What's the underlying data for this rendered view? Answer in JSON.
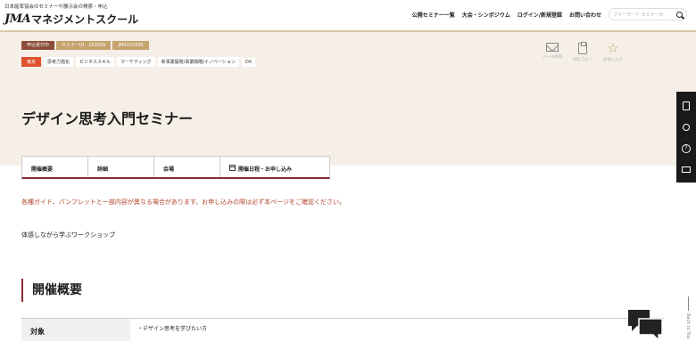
{
  "header": {
    "tagline": "日本能率協会のセミナーや展示会の検索・申込",
    "logo_jma": "JMA",
    "logo_rest": "マネジメントスクール",
    "nav": [
      {
        "label": "公開セミナー一覧"
      },
      {
        "label": "大会・シンポジウム"
      },
      {
        "label": "ログイン/新規登録"
      },
      {
        "label": "お問い合わせ"
      }
    ],
    "search_placeholder": "フリーワード セミナーの"
  },
  "seminar": {
    "status": "申込受付中",
    "seminar_id": "セミナーID：152095",
    "jma_id": "JMA152095",
    "location": "東京",
    "categories": [
      "思考力強化",
      "ビジネススキル",
      "マーケティング",
      "新事業開発/事業戦略/イノベーション",
      "DX"
    ],
    "title": "デザイン思考入門セミナー"
  },
  "actions": [
    {
      "label": "メール共有",
      "icon": "mail-share-icon"
    },
    {
      "label": "URLコピー",
      "icon": "clipboard-icon"
    },
    {
      "label": "お気に入り",
      "icon": "star-icon"
    }
  ],
  "tabs": [
    {
      "label": "開催概要"
    },
    {
      "label": "詳細"
    },
    {
      "label": "会場"
    },
    {
      "label": "開催日程・お申し込み"
    }
  ],
  "notice": "各種ガイド、パンフレットと一部内容が異なる場合があります。お申し込みの際は必ず本ページをご確認ください。",
  "lead": "体感しながら学ぶワークショップ",
  "section_heading": "開催概要",
  "overview_table": {
    "rows": [
      {
        "header": "対象",
        "value": "・デザイン思考を学びたい方"
      }
    ]
  },
  "sidebar": {
    "back_to_top": "Back to Top"
  }
}
